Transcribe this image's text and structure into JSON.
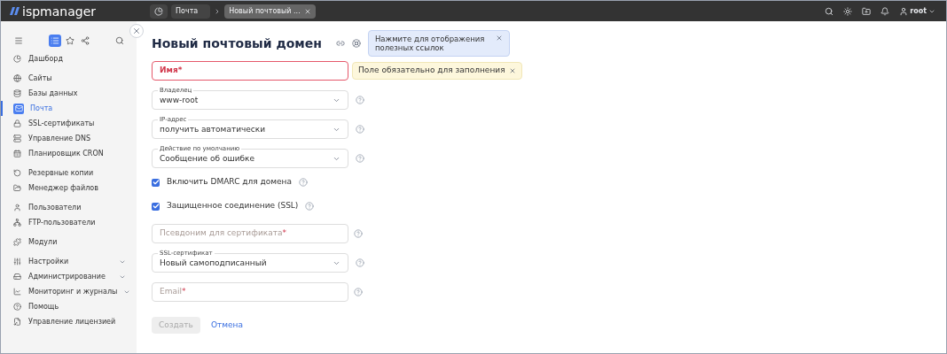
{
  "topbar": {
    "logo": "ispmanager",
    "breadcrumbs": [
      {
        "label": "Почта",
        "closable": false
      },
      {
        "label": "Новый почтовый ...",
        "closable": true
      }
    ],
    "user": "root"
  },
  "sidebar": {
    "tools": [
      {
        "selected": false
      },
      {
        "selected": true
      },
      {
        "selected": false
      },
      {
        "selected": false
      }
    ],
    "groups": [
      [
        {
          "label": "Дашборд",
          "selected": false,
          "kind": "link"
        }
      ],
      [
        {
          "label": "Сайты",
          "selected": false,
          "kind": "link"
        },
        {
          "label": "Базы данных",
          "selected": false,
          "kind": "link"
        },
        {
          "label": "Почта",
          "selected": true,
          "kind": "link"
        },
        {
          "label": "SSL-сертификаты",
          "selected": false,
          "kind": "link"
        },
        {
          "label": "Управление DNS",
          "selected": false,
          "kind": "link"
        },
        {
          "label": "Планировщик CRON",
          "selected": false,
          "kind": "link"
        }
      ],
      [
        {
          "label": "Резервные копии",
          "selected": false,
          "kind": "link"
        },
        {
          "label": "Менеджер файлов",
          "selected": false,
          "kind": "link"
        }
      ],
      [
        {
          "label": "Пользователи",
          "selected": false,
          "kind": "link"
        },
        {
          "label": "FTP-пользователи",
          "selected": false,
          "kind": "link"
        }
      ],
      [
        {
          "label": "Модули",
          "selected": false,
          "kind": "link"
        }
      ],
      [
        {
          "label": "Настройки",
          "selected": false,
          "kind": "section"
        },
        {
          "label": "Администрирование",
          "selected": false,
          "kind": "section"
        },
        {
          "label": "Мониторинг и журналы",
          "selected": false,
          "kind": "section"
        },
        {
          "label": "Помощь",
          "selected": false,
          "kind": "link"
        },
        {
          "label": "Управление лицензией",
          "selected": false,
          "kind": "link"
        }
      ]
    ]
  },
  "page": {
    "title": "Новый почтовый домен",
    "hint": "Нажмите для отображения полезных ссылок"
  },
  "form": {
    "fields": [
      {
        "kind": "text",
        "placeholder": "Имя",
        "required_mark": "*",
        "error": "Поле обязательно для заполнения",
        "help": false
      },
      {
        "kind": "select",
        "label": "Владелец",
        "value": "www-root",
        "help": true
      },
      {
        "kind": "select",
        "label": "IP-адрес",
        "value": "получить автоматически",
        "help": true
      },
      {
        "kind": "select",
        "label": "Действие по умолчанию",
        "value": "Сообщение об ошибке",
        "help": true
      },
      {
        "kind": "checkbox",
        "label": "Включить DMARC для домена",
        "checked": true,
        "help": true
      },
      {
        "kind": "checkbox",
        "label": "Защищенное соединение (SSL)",
        "checked": true,
        "help": true
      },
      {
        "kind": "text",
        "placeholder": "Псевдоним для сертификата",
        "required_mark": "*",
        "help": true
      },
      {
        "kind": "select",
        "label": "SSL-сертификат",
        "value": "Новый самоподписанный",
        "help": true
      },
      {
        "kind": "text",
        "placeholder": "Email",
        "required_mark": "*",
        "help": true
      }
    ],
    "buttons": [
      {
        "label": "Создать",
        "kind": "primary",
        "disabled": true
      },
      {
        "label": "Отмена",
        "kind": "link",
        "disabled": false
      }
    ]
  }
}
